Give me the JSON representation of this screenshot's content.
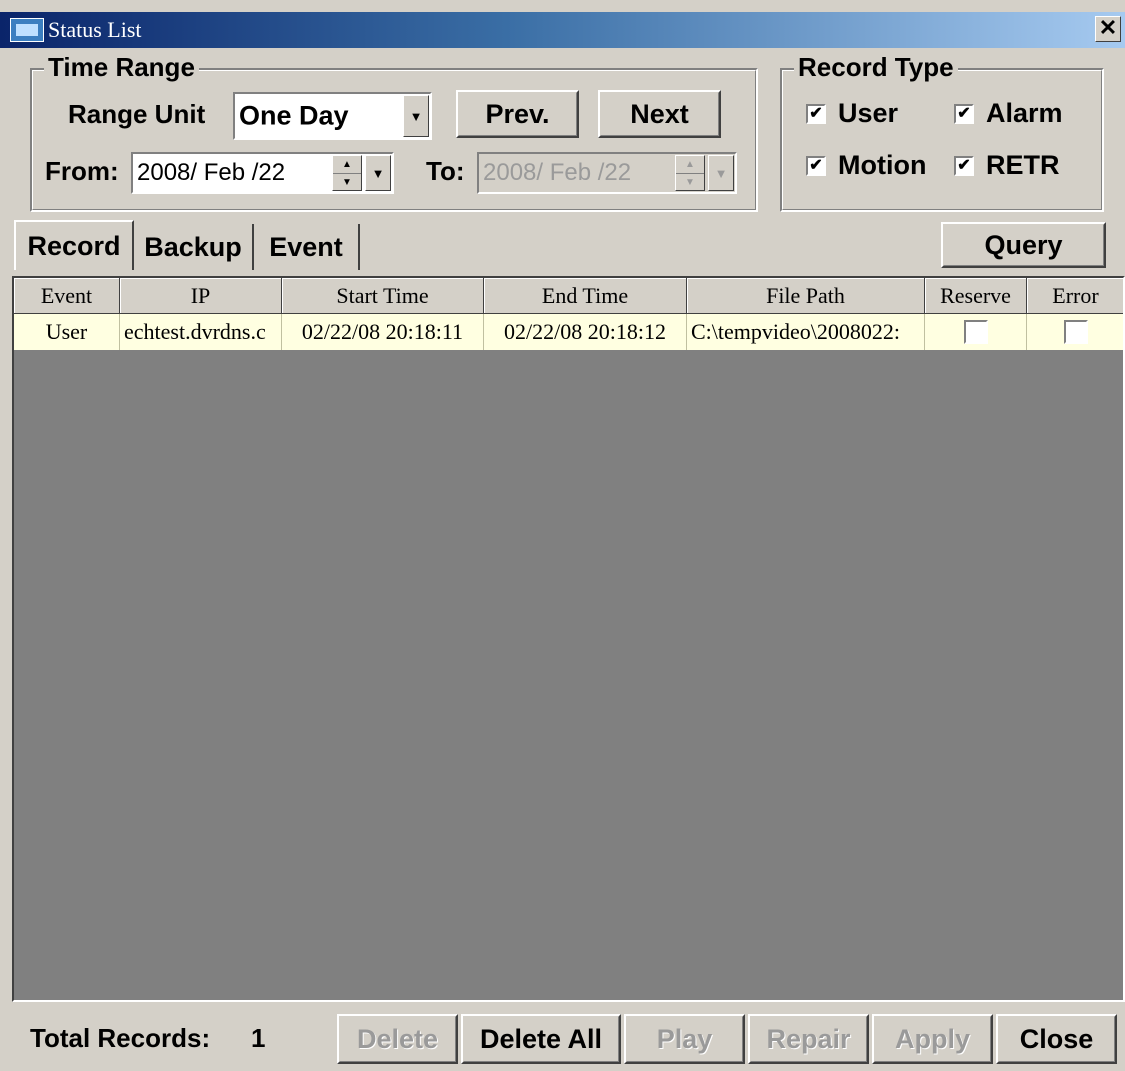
{
  "window": {
    "title": "Status List",
    "close_glyph": "✕"
  },
  "time_range": {
    "legend": "Time Range",
    "range_unit_label": "Range Unit",
    "range_unit_value": "One Day",
    "prev_label": "Prev.",
    "next_label": "Next",
    "from_label": "From:",
    "from_value": "2008/ Feb /22",
    "to_label": "To:",
    "to_value": "2008/ Feb /22"
  },
  "record_type": {
    "legend": "Record Type",
    "options": [
      {
        "label": "User",
        "checked": true
      },
      {
        "label": "Alarm",
        "checked": true
      },
      {
        "label": "Motion",
        "checked": true
      },
      {
        "label": "RETR",
        "checked": true
      }
    ]
  },
  "tabs": [
    {
      "label": "Record",
      "active": true
    },
    {
      "label": "Backup",
      "active": false
    },
    {
      "label": "Event",
      "active": false
    }
  ],
  "query_label": "Query",
  "table": {
    "columns": [
      "Event",
      "IP",
      "Start Time",
      "End Time",
      "File Path",
      "Reserve",
      "Error"
    ],
    "rows": [
      {
        "event": "User",
        "ip": "echtest.dvrdns.c",
        "start_time": "02/22/08 20:18:11",
        "end_time": "02/22/08 20:18:12",
        "file_path": "C:\\tempvideo\\2008022:",
        "reserve": false,
        "error": false
      }
    ]
  },
  "footer": {
    "total_label": "Total Records:",
    "total_value": "1",
    "buttons": {
      "delete": "Delete",
      "delete_all": "Delete All",
      "play": "Play",
      "repair": "Repair",
      "apply": "Apply",
      "close": "Close"
    }
  },
  "colors": {
    "face": "#d4d0c8",
    "titlebar_start": "#0a246a",
    "titlebar_end": "#a6caf0",
    "row_highlight": "#ffffe1",
    "grid_background": "#808080"
  },
  "icons": {
    "app": "app-window-icon",
    "checkmark": "✔",
    "dropdown": "▼",
    "spin_up": "▲",
    "spin_down": "▼"
  }
}
